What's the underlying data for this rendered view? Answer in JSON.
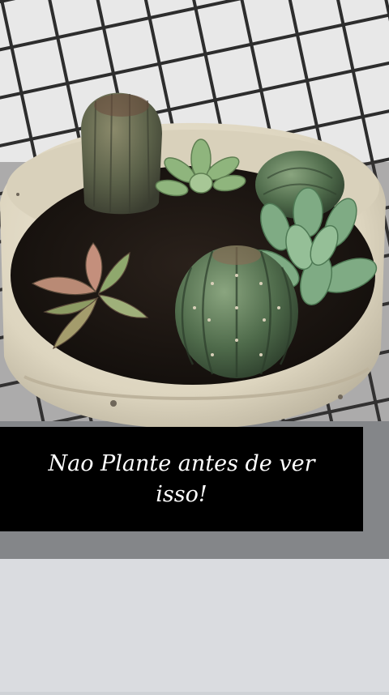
{
  "caption": {
    "text": "Nao Plante antes de ver isso!"
  },
  "photo": {
    "subject": "potted-succulents-and-cacti",
    "colors": {
      "net_background": "#e9e9e9",
      "net_lines": "#2b2b2b",
      "pot": "#e8e2cf",
      "soil": "#1c1612",
      "cactus": "#4d6a4a",
      "succulent": "#7fa67a",
      "counter": "#c3c6ca",
      "caption_bg": "#000000",
      "caption_fg": "#ffffff"
    }
  }
}
